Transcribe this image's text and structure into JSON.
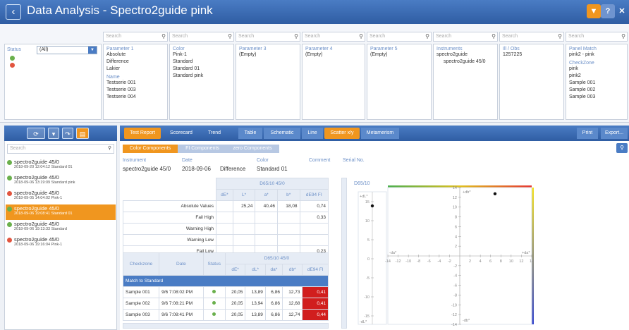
{
  "window": {
    "back_icon": "back-chevron-icon",
    "title": "Data Analysis - Spectro2guide pink"
  },
  "titlebar_buttons": [
    "t-menu-icon",
    "?",
    "close-x"
  ],
  "filters": {
    "search_placeholder": "Search",
    "status": {
      "label": "Status",
      "selected": "(All)",
      "dots": [
        "#6ab04c",
        "#e2553f"
      ]
    },
    "parameter1": {
      "heading": "Parameter 1",
      "items": [
        "Absolute",
        "Difference",
        "Lakier"
      ],
      "heading2": "Name",
      "items2": [
        "Testserie 001",
        "Testserie 003",
        "Testserie 004"
      ]
    },
    "color": {
      "heading": "Color",
      "items": [
        "Pink-1",
        "Standard",
        "Standard 01",
        "Standard pink"
      ]
    },
    "parameter3": {
      "heading": "Parameter 3",
      "items": [
        "(Empty)"
      ]
    },
    "parameter4": {
      "heading": "Parameter 4",
      "items": [
        "(Empty)"
      ]
    },
    "parameter5": {
      "heading": "Parameter 5",
      "items": [
        "(Empty)"
      ]
    },
    "instruments": {
      "heading": "Instruments",
      "items": [
        "spectro2guide",
        "spectro2guide 45/0"
      ]
    },
    "illobs": {
      "heading": "Ill / Obs",
      "items": [
        "1257225"
      ]
    },
    "panelmatch": {
      "heading": "Panel Match",
      "items": [
        "pink2 - pink"
      ],
      "heading2": "CheckZone",
      "items2": [
        "pink",
        "pink2",
        "Sample 001",
        "Sample 002",
        "Sample 003"
      ]
    }
  },
  "left": {
    "search_placeholder": "Search",
    "items": [
      {
        "name": "spectro2guide 45/0",
        "detail": "2018-09-20 12:04:12  Standard 01",
        "color": "#6ab04c"
      },
      {
        "name": "spectro2guide 45/0",
        "detail": "2018-09-06 13:19:09  Standard pink",
        "color": "#6ab04c"
      },
      {
        "name": "spectro2guide 45/0",
        "detail": "2018-09-05 14:04:02  Pink-1",
        "color": "#e2553f"
      },
      {
        "name": "spectro2guide 45/0",
        "detail": "2018-09-06 19:08:41  Standard 01",
        "color": "#6ab04c",
        "selected": true
      },
      {
        "name": "spectro2guide 45/0",
        "detail": "2018-09-06 19:13:33  Standard",
        "color": "#6ab04c"
      },
      {
        "name": "spectro2guide 45/0",
        "detail": "2018-09-06 19:16:04  Pink-1",
        "color": "#e2553f"
      }
    ]
  },
  "tabs": {
    "report": [
      "Test Report",
      "Scorecard",
      "Trend"
    ],
    "views": [
      "Table",
      "Schematic",
      "Line",
      "Scatter x/y",
      "Metamerism"
    ],
    "print": "Print",
    "export": "Export..."
  },
  "subtabs": [
    "Color Components",
    "FI Components",
    "zero Components"
  ],
  "info": {
    "instrument_label": "Instrument",
    "instrument": "spectro2guide 45/0",
    "date_label": "Date",
    "date": "2018-09-06",
    "mode": "Difference",
    "color_label": "Color",
    "color": "Standard 01",
    "comment_label": "Comment",
    "serial_label": "Serial No."
  },
  "table1": {
    "group": "D65/10 45/0",
    "cols": [
      "dE*",
      "L*",
      "a*",
      "b*",
      "dE94 FI"
    ],
    "rows": [
      {
        "label": "Absolute Values",
        "vals": [
          "",
          "25,24",
          "40,46",
          "18,08",
          "0,74"
        ]
      },
      {
        "label": "Fail High",
        "vals": [
          "",
          "",
          "",
          "",
          "0,33"
        ]
      },
      {
        "label": "Warning High",
        "vals": [
          "",
          "",
          "",
          "",
          ""
        ]
      },
      {
        "label": "Warning Low",
        "vals": [
          "",
          "",
          "",
          "",
          ""
        ]
      },
      {
        "label": "Fail Low",
        "vals": [
          "",
          "",
          "",
          "",
          "0,23"
        ]
      }
    ]
  },
  "table2": {
    "heads": [
      "Checkzone",
      "Date",
      "Status"
    ],
    "group": "D65/10 45/0",
    "cols": [
      "dE*",
      "dL*",
      "da*",
      "db*",
      "dE94 FI"
    ],
    "match": "Match to Standard",
    "rows": [
      {
        "zone": "Sample 001",
        "date": "9/6 7:08:02 PM",
        "vals": [
          "20,05",
          "13,89",
          "6,86",
          "12,73",
          "0,41"
        ]
      },
      {
        "zone": "Sample 002",
        "date": "9/6 7:08:21 PM",
        "vals": [
          "20,05",
          "13,94",
          "6,86",
          "12,68",
          "0,41"
        ]
      },
      {
        "zone": "Sample 003",
        "date": "9/6 7:08:41 PM",
        "vals": [
          "20,05",
          "13,89",
          "6,86",
          "12,74",
          "0,44"
        ]
      }
    ]
  },
  "chart": {
    "illuminant": "D65/10",
    "dl_label": "+dL*",
    "dl_neg": "-dL*",
    "db_pos": "+db*",
    "db_neg": "-db*",
    "da_pos": "+da*",
    "da_neg": "-da*",
    "dl_ticks": [
      "15",
      "10",
      "5",
      "0",
      "-5",
      "-10",
      "-15"
    ],
    "x_ticks": [
      "-14",
      "-12",
      "-10",
      "-8",
      "-6",
      "-4",
      "-2",
      "2",
      "4",
      "6",
      "8",
      "10",
      "12",
      "14"
    ],
    "y_ticks": [
      "14",
      "12",
      "10",
      "8",
      "6",
      "4",
      "2",
      "-2",
      "-4",
      "-6",
      "-8",
      "-10",
      "-12",
      "-14"
    ]
  },
  "chart_data": {
    "type": "scatter",
    "title": "D65/10",
    "points_dL": [
      13.89
    ],
    "points_ab": [
      {
        "x": 6.86,
        "y": 12.73
      }
    ],
    "xlim": [
      -14,
      14
    ],
    "ylim": [
      -14,
      14
    ],
    "dl_lim": [
      -15,
      15
    ]
  }
}
